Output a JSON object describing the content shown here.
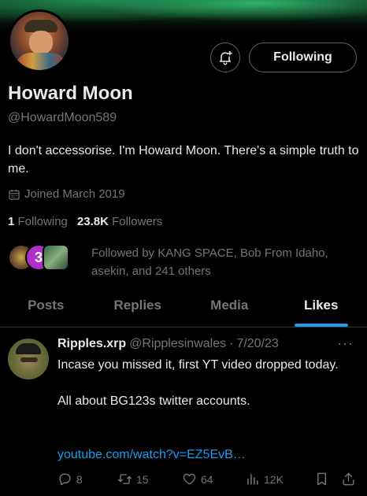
{
  "profile": {
    "name": "Howard Moon",
    "handle": "@HowardMoon589",
    "bio": "I don't accessorise. I'm Howard Moon. There's a simple truth to me.",
    "joined": "Joined March 2019",
    "following_count": "1",
    "following_label": "Following",
    "followers_count": "23.8K",
    "followers_label": "Followers",
    "followed_by_text": "Followed by KANG SPACE, Bob From Idaho, asekin, and 241 others",
    "followed_badge": "3"
  },
  "buttons": {
    "follow_label": "Following"
  },
  "tabs": [
    {
      "label": "Posts",
      "active": false
    },
    {
      "label": "Replies",
      "active": false
    },
    {
      "label": "Media",
      "active": false
    },
    {
      "label": "Likes",
      "active": true
    }
  ],
  "tweet": {
    "author_name": "Ripples.xrp",
    "author_handle": "@Ripplesinwales",
    "separator": "·",
    "date": "7/20/23",
    "more": "···",
    "lines": [
      "Incase you missed it, first YT video dropped today.",
      "All about BG123s twitter accounts."
    ],
    "link": "youtube.com/watch?v=EZ5EvB…",
    "replies": "8",
    "reposts": "15",
    "likes": "64",
    "views": "12K"
  },
  "colors": {
    "accent": "#1d9bf0",
    "muted": "#71767b",
    "text": "#e7e9ea",
    "background": "#000000"
  },
  "icons": [
    "bell-plus-icon",
    "calendar-icon",
    "reply-icon",
    "repost-icon",
    "like-icon",
    "views-icon",
    "bookmark-icon",
    "share-icon"
  ]
}
